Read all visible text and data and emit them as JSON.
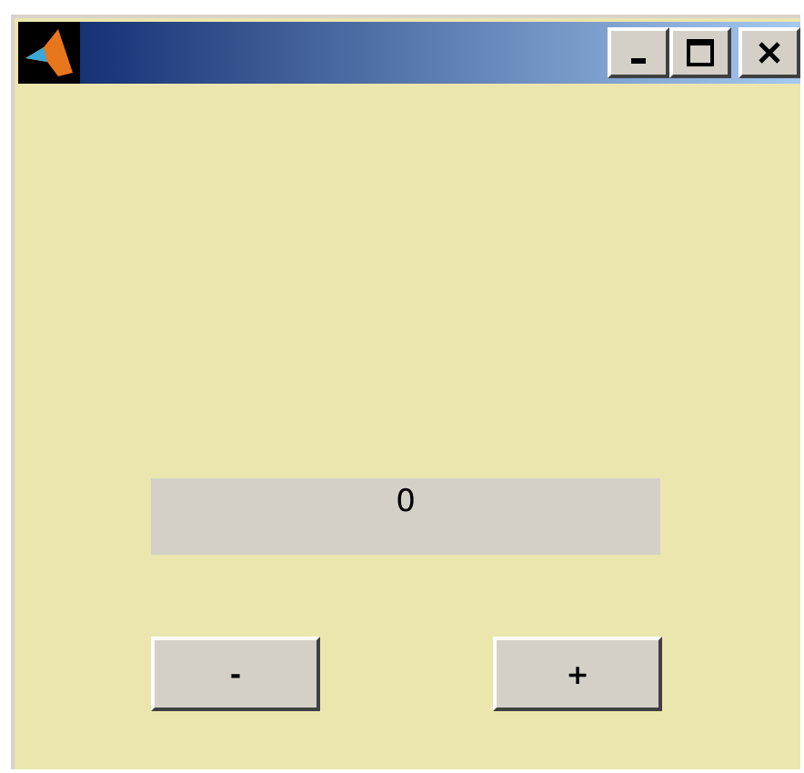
{
  "display": {
    "value": "0"
  },
  "buttons": [
    {
      "label": "-"
    },
    {
      "label": "+"
    }
  ]
}
